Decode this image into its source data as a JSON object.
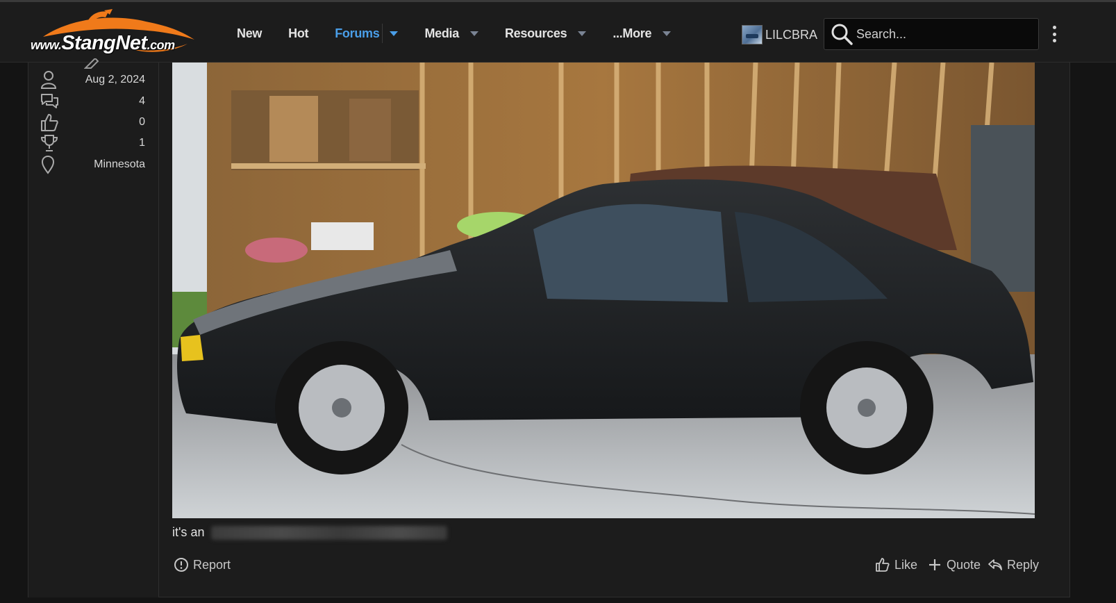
{
  "site": {
    "logo_prefix": "www.",
    "logo_name": "StangNet",
    "logo_suffix": ".com",
    "accent_color": "#f07a1a",
    "link_color": "#4a9ee8"
  },
  "nav": {
    "items": [
      {
        "label": "New",
        "has_menu": false,
        "active": false
      },
      {
        "label": "Hot",
        "has_menu": false,
        "active": false
      },
      {
        "label": "Forums",
        "has_menu": true,
        "active": true
      },
      {
        "label": "Media",
        "has_menu": true,
        "active": false
      },
      {
        "label": "Resources",
        "has_menu": true,
        "active": false
      },
      {
        "label": "...More",
        "has_menu": true,
        "active": false
      }
    ]
  },
  "account": {
    "username": "LILCBRA"
  },
  "search": {
    "placeholder": "Search..."
  },
  "author_stats": {
    "joined": "Aug 2, 2024",
    "messages": "4",
    "reaction_score": "0",
    "points": "1",
    "location": "Minnesota"
  },
  "post": {
    "image_alt": "black fox body Mustang hatchback parked in a garage",
    "text": "it's an"
  },
  "actions": {
    "report": "Report",
    "like": "Like",
    "quote": "Quote",
    "reply": "Reply"
  }
}
